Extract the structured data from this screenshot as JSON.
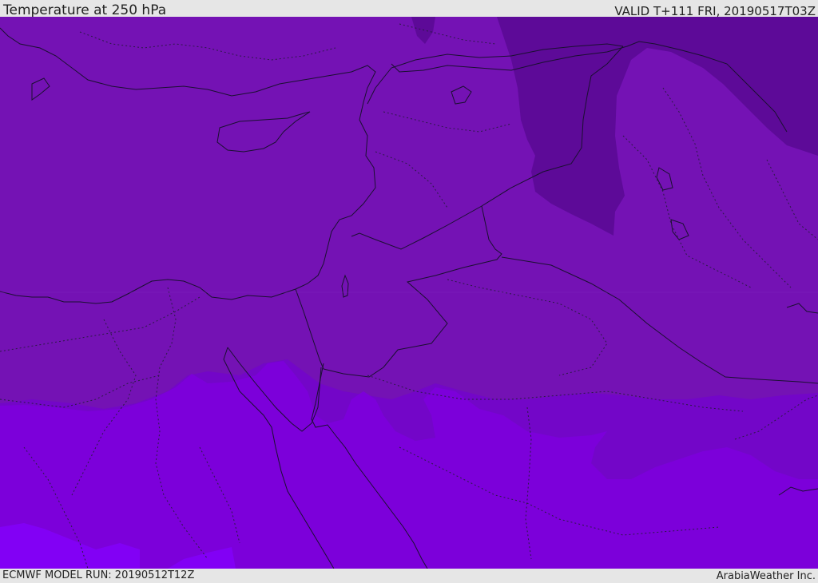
{
  "header": {
    "title": "Temperature at 250 hPa",
    "valid": "VALID T+111 FRI, 20190517T03Z"
  },
  "footer": {
    "run": "ECMWF MODEL RUN: 20190512T12Z",
    "credit": "ArabiaWeather Inc."
  },
  "map": {
    "colors": {
      "base": "#7412b4",
      "warm_core": "#5d0a98",
      "cool_band": "#7306c8",
      "cooler": "#7c00da",
      "coldest": "#8200f5",
      "lines": "#1a1030"
    }
  }
}
